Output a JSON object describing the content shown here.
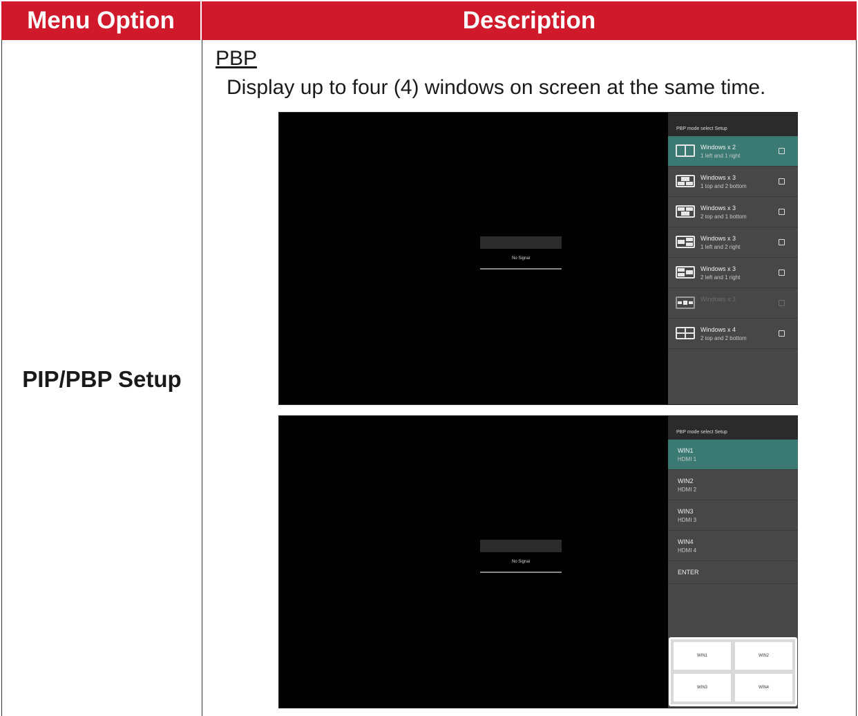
{
  "table": {
    "header": {
      "col1": "Menu Option",
      "col2": "Description"
    },
    "menu_option": "PIP/PBP Setup"
  },
  "description": {
    "sub_heading": "PBP",
    "text": "Display up to four (4) windows on screen at the same time."
  },
  "screen1": {
    "no_signal": "No Signal",
    "panel_title": "PBP mode select Setup",
    "options": [
      {
        "title": "Windows x 2",
        "subtitle": "1 left and 1 right",
        "icon": "layout-2-split-icon",
        "selected": true,
        "enabled": true
      },
      {
        "title": "Windows x 3",
        "subtitle": "1 top and 2 bottom",
        "icon": "layout-1top-2bottom-icon",
        "selected": false,
        "enabled": true
      },
      {
        "title": "Windows x 3",
        "subtitle": "2 top and 1 bottom",
        "icon": "layout-2top-1bottom-icon",
        "selected": false,
        "enabled": true
      },
      {
        "title": "Windows x 3",
        "subtitle": "1 left and 2 right",
        "icon": "layout-1left-2right-icon",
        "selected": false,
        "enabled": true
      },
      {
        "title": "Windows x 3",
        "subtitle": "2 left and 1 right",
        "icon": "layout-2left-1right-icon",
        "selected": false,
        "enabled": true
      },
      {
        "title": "Windows x 3",
        "subtitle": "",
        "icon": "layout-3-horizontal-icon",
        "selected": false,
        "enabled": false
      },
      {
        "title": "Windows x 4",
        "subtitle": "2 top and 2 bottom",
        "icon": "layout-4-grid-icon",
        "selected": false,
        "enabled": true
      }
    ]
  },
  "screen2": {
    "no_signal": "No Signal",
    "panel_title": "PBP mode select Setup",
    "windows": [
      {
        "name": "WIN1",
        "source": "HDMI 1",
        "selected": true
      },
      {
        "name": "WIN2",
        "source": "HDMI 2",
        "selected": false
      },
      {
        "name": "WIN3",
        "source": "HDMI 3",
        "selected": false
      },
      {
        "name": "WIN4",
        "source": "HDMI 4",
        "selected": false
      }
    ],
    "enter_label": "ENTER",
    "grid_labels": [
      "WIN1",
      "WIN2",
      "WIN3",
      "WIN4"
    ]
  },
  "colors": {
    "header_red": "#d0192b",
    "selected_teal": "#3b7a72",
    "panel_gray": "#474747"
  }
}
